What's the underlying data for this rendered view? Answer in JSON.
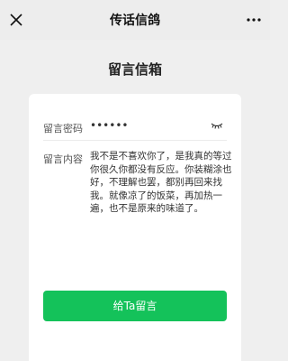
{
  "app": {
    "title": "传话信鸽"
  },
  "page": {
    "title": "留言信箱"
  },
  "form": {
    "password_label": "留言密码",
    "password_value": "••••••",
    "message_label": "留言内容",
    "message_text": "我不是不喜欢你了，是我真的等过你很久你都没有反应。你装糊涂也好，不理解也罢，都别再回来找我。就像凉了的饭菜，再加热一遍，也不是原来的味道了。"
  },
  "actions": {
    "submit_label": "给Ta留言"
  },
  "colors": {
    "accent": "#14c25a",
    "background": "#efefef",
    "card": "#ffffff"
  },
  "icons": {
    "close": "close-icon",
    "more": "more-icon",
    "eye": "eye-closed-icon"
  }
}
